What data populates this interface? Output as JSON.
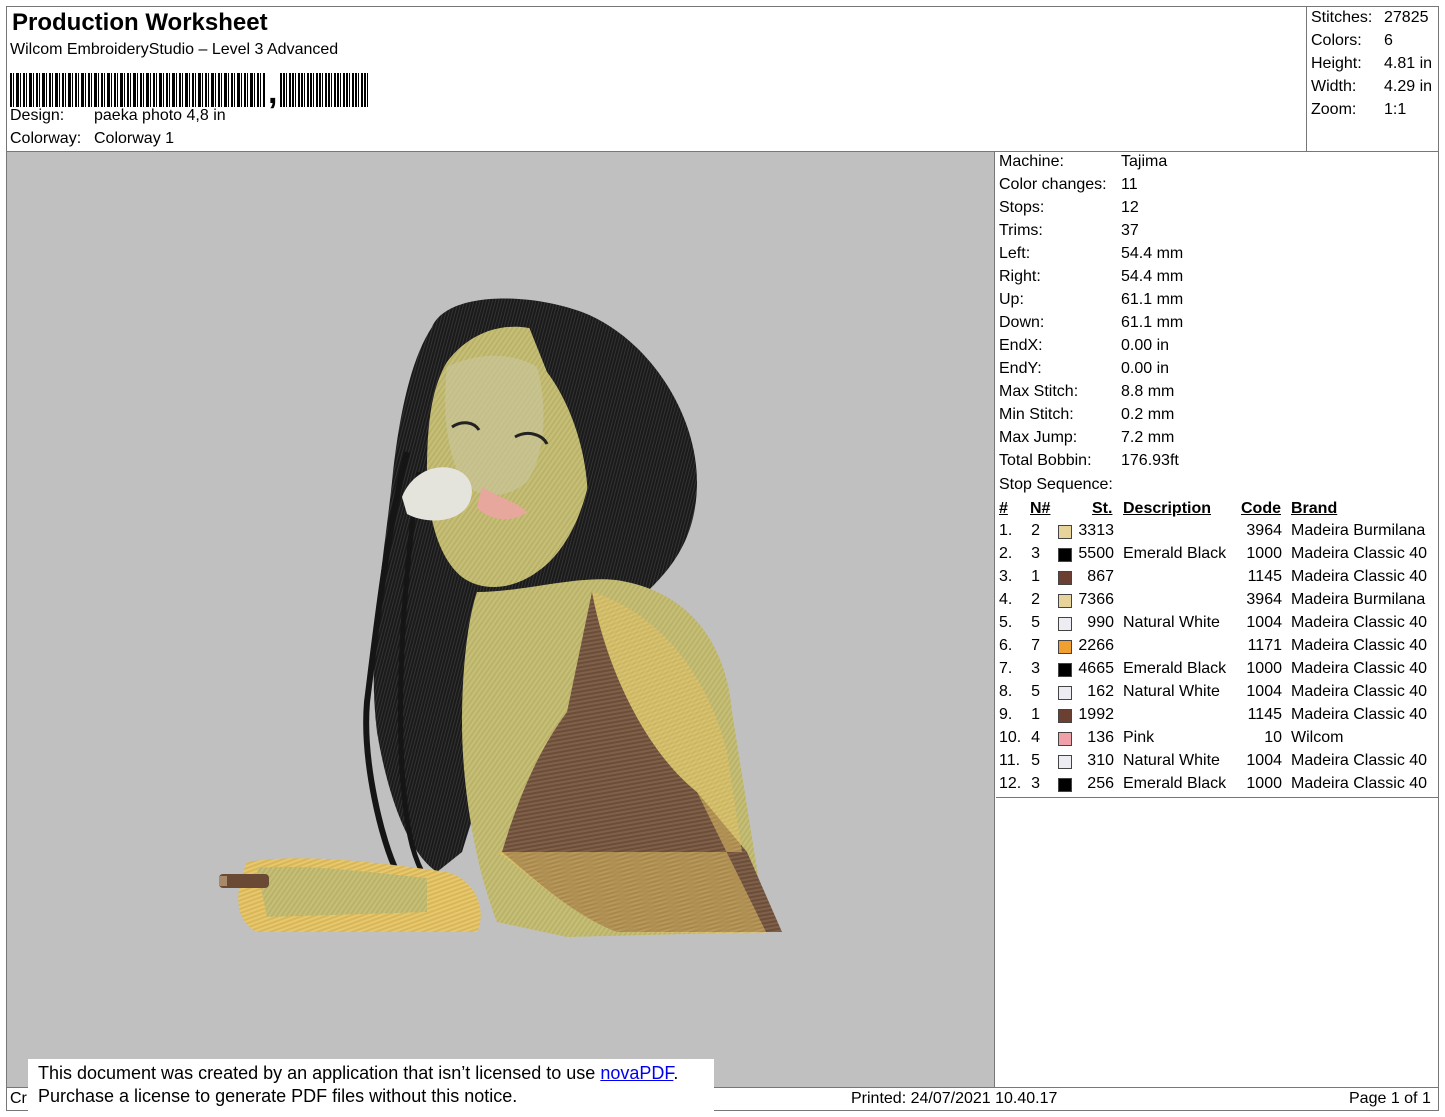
{
  "header": {
    "title": "Production Worksheet",
    "subtitle": "Wilcom EmbroideryStudio – Level 3 Advanced",
    "barcode_icon": "barcode-icon",
    "design_label": "Design:",
    "design_value": "paeka photo 4,8 in",
    "colorway_label": "Colorway:",
    "colorway_value": "Colorway 1"
  },
  "summary": [
    {
      "label": "Stitches:",
      "value": "27825"
    },
    {
      "label": "Colors:",
      "value": "6"
    },
    {
      "label": "Height:",
      "value": "4.81 in"
    },
    {
      "label": "Width:",
      "value": "4.29 in"
    },
    {
      "label": "Zoom:",
      "value": "1:1"
    }
  ],
  "stats": [
    {
      "label": "Machine:",
      "value": "Tajima"
    },
    {
      "label": "Color changes:",
      "value": "11"
    },
    {
      "label": "Stops:",
      "value": "12"
    },
    {
      "label": "Trims:",
      "value": "37"
    },
    {
      "label": "Left:",
      "value": "54.4 mm"
    },
    {
      "label": "Right:",
      "value": "54.4 mm"
    },
    {
      "label": "Up:",
      "value": "61.1 mm"
    },
    {
      "label": "Down:",
      "value": "61.1 mm"
    },
    {
      "label": "EndX:",
      "value": "0.00 in"
    },
    {
      "label": "EndY:",
      "value": "0.00 in"
    },
    {
      "label": "Max Stitch:",
      "value": "8.8 mm"
    },
    {
      "label": "Min Stitch:",
      "value": "0.2 mm"
    },
    {
      "label": "Max Jump:",
      "value": "7.2 mm"
    },
    {
      "label": "Total Bobbin:",
      "value": "176.93ft"
    }
  ],
  "stop_sequence": {
    "label": "Stop Sequence:",
    "headers": {
      "num": "#",
      "n": "N#",
      "st": "St.",
      "desc": "Description",
      "code": "Code",
      "brand": "Brand"
    },
    "rows": [
      {
        "num": "1.",
        "n": "2",
        "color": "#e6d49a",
        "st": "3313",
        "desc": "",
        "code": "3964",
        "brand": "Madeira Burmilana"
      },
      {
        "num": "2.",
        "n": "3",
        "color": "#000000",
        "st": "5500",
        "desc": "Emerald Black",
        "code": "1000",
        "brand": "Madeira Classic 40"
      },
      {
        "num": "3.",
        "n": "1",
        "color": "#6b4033",
        "st": "867",
        "desc": "",
        "code": "1145",
        "brand": "Madeira Classic 40"
      },
      {
        "num": "4.",
        "n": "2",
        "color": "#e6d49a",
        "st": "7366",
        "desc": "",
        "code": "3964",
        "brand": "Madeira Burmilana"
      },
      {
        "num": "5.",
        "n": "5",
        "color": "#ececf2",
        "st": "990",
        "desc": "Natural White",
        "code": "1004",
        "brand": "Madeira Classic 40"
      },
      {
        "num": "6.",
        "n": "7",
        "color": "#f0a030",
        "st": "2266",
        "desc": "",
        "code": "1171",
        "brand": "Madeira Classic 40"
      },
      {
        "num": "7.",
        "n": "3",
        "color": "#000000",
        "st": "4665",
        "desc": "Emerald Black",
        "code": "1000",
        "brand": "Madeira Classic 40"
      },
      {
        "num": "8.",
        "n": "5",
        "color": "#ececf2",
        "st": "162",
        "desc": "Natural White",
        "code": "1004",
        "brand": "Madeira Classic 40"
      },
      {
        "num": "9.",
        "n": "1",
        "color": "#6b4033",
        "st": "1992",
        "desc": "",
        "code": "1145",
        "brand": "Madeira Classic 40"
      },
      {
        "num": "10.",
        "n": "4",
        "color": "#f0a0a8",
        "st": "136",
        "desc": "Pink",
        "code": "10",
        "brand": "Wilcom"
      },
      {
        "num": "11.",
        "n": "5",
        "color": "#ececf2",
        "st": "310",
        "desc": "Natural White",
        "code": "1004",
        "brand": "Madeira Classic 40"
      },
      {
        "num": "12.",
        "n": "3",
        "color": "#000000",
        "st": "256",
        "desc": "Emerald Black",
        "code": "1000",
        "brand": "Madeira Classic 40"
      }
    ]
  },
  "preview": {
    "background": "#c0c0c0",
    "image": "embroidery-design-preview"
  },
  "footer": {
    "cr": "Cr",
    "printed": "Printed: 24/07/2021 10.40.17",
    "page": "Page 1 of 1",
    "notice_line1": "This document was created by an application that isn’t licensed to use ",
    "notice_link": "novaPDF",
    "notice_line1_end": ".",
    "notice_line2": "Purchase a license to generate PDF files without this notice."
  }
}
